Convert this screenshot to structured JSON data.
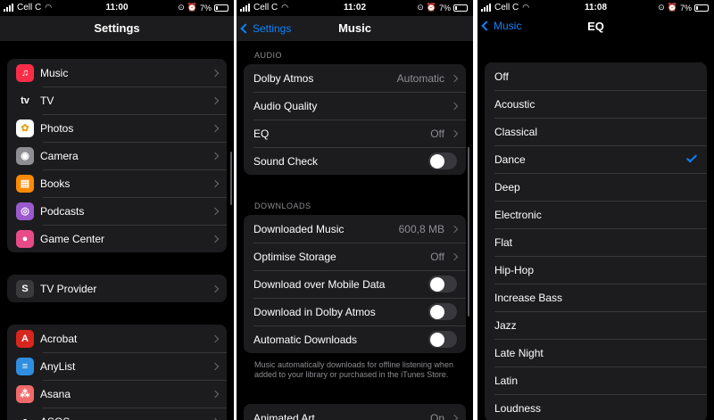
{
  "colors": {
    "background": "#000000",
    "cell": "#1c1c1e",
    "accent": "#0a84ff",
    "secondary_text": "#8e8e93"
  },
  "panel1": {
    "status": {
      "carrier": "Cell C",
      "time": "11:00",
      "battery": "7%"
    },
    "nav_title": "Settings",
    "group1": [
      {
        "label": "Music",
        "icon": "music-icon",
        "color": "#fa2d48",
        "glyph": "♫"
      },
      {
        "label": "TV",
        "icon": "apple-tv-icon",
        "color": "#1c1c1e",
        "glyph": "tv"
      },
      {
        "label": "Photos",
        "icon": "photos-icon",
        "color": "#ffffff",
        "glyph": "✿"
      },
      {
        "label": "Camera",
        "icon": "camera-icon",
        "color": "#8e8e93",
        "glyph": "◉"
      },
      {
        "label": "Books",
        "icon": "books-icon",
        "color": "#ff8a00",
        "glyph": "▤"
      },
      {
        "label": "Podcasts",
        "icon": "podcasts-icon",
        "color": "#9b59d0",
        "glyph": "◎"
      },
      {
        "label": "Game Center",
        "icon": "game-center-icon",
        "color": "#e84c88",
        "glyph": "●"
      }
    ],
    "group2": [
      {
        "label": "TV Provider",
        "icon": "tv-provider-icon",
        "color": "#3a3a3c",
        "glyph": "S"
      }
    ],
    "group3": [
      {
        "label": "Acrobat",
        "icon": "acrobat-icon",
        "color": "#d7261e",
        "glyph": "A"
      },
      {
        "label": "AnyList",
        "icon": "anylist-icon",
        "color": "#2f8ee0",
        "glyph": "≡"
      },
      {
        "label": "Asana",
        "icon": "asana-icon",
        "color": "#f06a6a",
        "glyph": "⁂"
      },
      {
        "label": "ASOS",
        "icon": "asos-icon",
        "color": "#1c1c1e",
        "glyph": "a"
      }
    ]
  },
  "panel2": {
    "status": {
      "carrier": "Cell C",
      "time": "11:02",
      "battery": "7%"
    },
    "back_label": "Settings",
    "nav_title": "Music",
    "audio_header": "AUDIO",
    "audio_rows": [
      {
        "label": "Dolby Atmos",
        "value": "Automatic",
        "kind": "chevron"
      },
      {
        "label": "Audio Quality",
        "value": "",
        "kind": "chevron"
      },
      {
        "label": "EQ",
        "value": "Off",
        "kind": "chevron"
      },
      {
        "label": "Sound Check",
        "value": "",
        "kind": "toggle",
        "on": false
      }
    ],
    "downloads_header": "DOWNLOADS",
    "download_rows": [
      {
        "label": "Downloaded Music",
        "value": "600,8 MB",
        "kind": "chevron"
      },
      {
        "label": "Optimise Storage",
        "value": "Off",
        "kind": "chevron"
      },
      {
        "label": "Download over Mobile Data",
        "value": "",
        "kind": "toggle",
        "on": false
      },
      {
        "label": "Download in Dolby Atmos",
        "value": "",
        "kind": "toggle",
        "on": false
      },
      {
        "label": "Automatic Downloads",
        "value": "",
        "kind": "toggle",
        "on": false
      }
    ],
    "downloads_footer": "Music automatically downloads for offline listening when added to your library or purchased in the iTunes Store.",
    "bottom_rows": [
      {
        "label": "Animated Art",
        "value": "On",
        "kind": "chevron"
      }
    ]
  },
  "panel3": {
    "status": {
      "carrier": "Cell C",
      "time": "11:08",
      "battery": "7%"
    },
    "back_label": "Music",
    "nav_title": "EQ",
    "selected": "Dance",
    "options": [
      "Off",
      "Acoustic",
      "Classical",
      "Dance",
      "Deep",
      "Electronic",
      "Flat",
      "Hip-Hop",
      "Increase Bass",
      "Jazz",
      "Late Night",
      "Latin",
      "Loudness"
    ]
  }
}
